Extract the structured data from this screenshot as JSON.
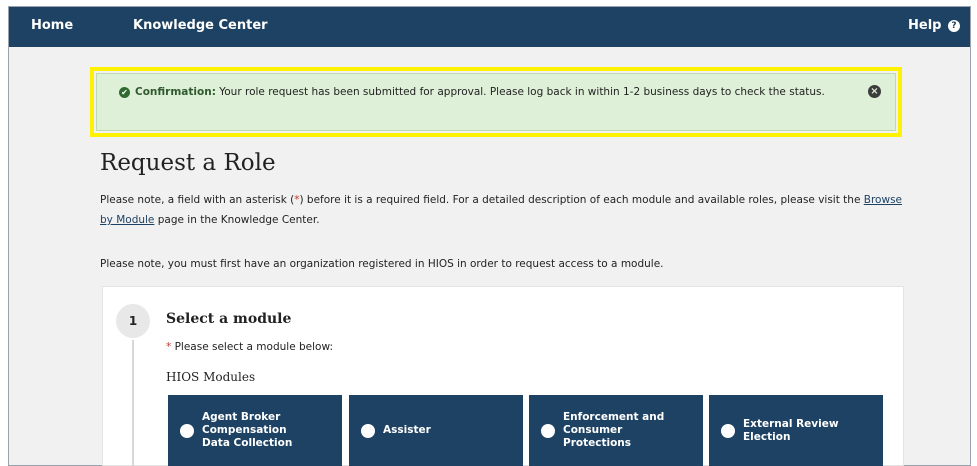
{
  "nav": {
    "home": "Home",
    "knowledge_center": "Knowledge Center",
    "help": "Help",
    "help_icon": "question-circle-icon"
  },
  "alert": {
    "label": "Confirmation:",
    "message": " Your role request has been submitted for approval. Please log back in within 1-2 business days to check the status.",
    "icons": [
      "check-circle-icon",
      "close-circle-icon"
    ],
    "highlight_color": "#fff200",
    "background": "#dff0d8"
  },
  "page": {
    "title": "Request a Role",
    "para1_a": "Please note, a field with an asterisk (",
    "para1_asterisk": "*",
    "para1_b": ") before it is a required field. For a detailed description of each module and available roles, please visit the ",
    "para1_link": "Browse by Module",
    "para1_c": " page in the Knowledge Center.",
    "para2": "Please note, you must first have an organization registered in HIOS in order to request access to a module."
  },
  "step": {
    "number": "1",
    "title": "Select a module",
    "required_mark": "*",
    "instruction": " Please select a module below:",
    "group_label": "HIOS Modules"
  },
  "modules": [
    {
      "label": "Agent Broker Compensation Data Collection"
    },
    {
      "label": "Assister"
    },
    {
      "label": "Enforcement and Consumer Protections"
    },
    {
      "label": "External Review Election"
    }
  ],
  "colors": {
    "nav_bg": "#1d4263",
    "module_bg": "#1d4263",
    "page_bg": "#f1f1f1"
  }
}
